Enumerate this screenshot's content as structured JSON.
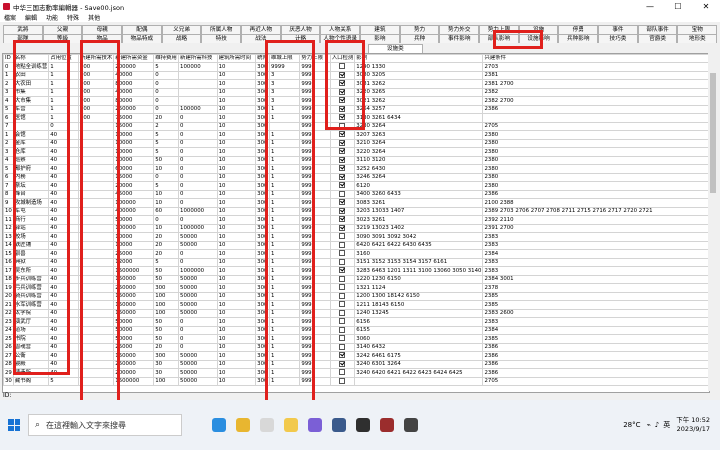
{
  "window": {
    "title": "中华三国志動率編輯器 - Save00.json",
    "minimize": "—",
    "maximize": "☐",
    "close": "✕"
  },
  "menu": [
    "檔案",
    "編輯",
    "功能",
    "特殊",
    "其他"
  ],
  "tabs_row1": [
    "武將",
    "父親",
    "母親",
    "配偶",
    "义兄弟",
    "所属人物",
    "再近人物",
    "厌恶人物",
    "人物关系",
    "建筑",
    "势力",
    "势力外交",
    "势力上限",
    "设施",
    "停勇",
    "事件",
    "部队事件",
    "宝物"
  ],
  "tabs_row2": [
    "部隊",
    "等級",
    "物品",
    "物品特成",
    "战略",
    "特技",
    "战法",
    "计略",
    "人物个性语录",
    "影响",
    "兵种",
    "事件影响",
    "部队影响",
    "设施影响",
    "兵种影响",
    "技巧类",
    "官爵类",
    "地形类"
  ],
  "active_tab": "设施类",
  "columns": [
    "ID",
    "名称",
    "占用位置",
    "新建所需技术",
    "新建所需资金",
    "维持费用",
    "新建所需科技",
    "建筑所需时间",
    "统帅",
    "维城上限",
    "势力上限",
    "入口检测",
    "影响",
    "兴建条件"
  ],
  "rows": [
    [
      "0",
      "地點全训练营",
      "1",
      "100",
      "200000",
      "5",
      "100000",
      "10",
      "300",
      "9999",
      "9999",
      "☐",
      "1290 1330",
      "2703"
    ],
    [
      "1",
      "农田",
      "1",
      "100",
      "40000",
      "0",
      "",
      "10",
      "300",
      "3",
      "9999",
      "☑",
      "3080 3205",
      "2381"
    ],
    [
      "2",
      "大农田",
      "1",
      "100",
      "80000",
      "0",
      "",
      "10",
      "300",
      "3",
      "9999",
      "☑",
      "3081 3262",
      "2381 2700"
    ],
    [
      "3",
      "市集",
      "1",
      "100",
      "40000",
      "0",
      "",
      "10",
      "300",
      "3",
      "9999",
      "☑",
      "3220 3265",
      "2382"
    ],
    [
      "4",
      "大市集",
      "1",
      "100",
      "80000",
      "0",
      "",
      "10",
      "300",
      "3",
      "9999",
      "☑",
      "3021 3262",
      "2382 2700"
    ],
    [
      "5",
      "军营",
      "1",
      "100",
      "250000",
      "0",
      "100000",
      "10",
      "300",
      "1",
      "9999",
      "☑",
      "3264 3257",
      "2386"
    ],
    [
      "6",
      "医馆",
      "1",
      "100",
      "75000",
      "20",
      "0",
      "10",
      "300",
      "1",
      "9999",
      "☑",
      "3130 3261 6434",
      ""
    ],
    [
      "7",
      "",
      "0",
      "",
      "15000",
      "2",
      "0",
      "10",
      "300",
      "",
      "9999",
      "☐",
      "3230 3264",
      "2705"
    ],
    [
      "1",
      "会馆",
      "40",
      "1",
      "10000",
      "5",
      "0",
      "10",
      "300",
      "1",
      "9999",
      "☑",
      "3207 3263",
      "2380"
    ],
    [
      "2",
      "金库",
      "40",
      "1",
      "10000",
      "5",
      "0",
      "10",
      "300",
      "1",
      "9999",
      "☑",
      "3210 3264",
      "2380"
    ],
    [
      "3",
      "仓库",
      "40",
      "1",
      "10000",
      "5",
      "0",
      "10",
      "300",
      "1",
      "9999",
      "☑",
      "3220 3264",
      "2380"
    ],
    [
      "4",
      "巡察",
      "40",
      "1",
      "10000",
      "50",
      "0",
      "10",
      "300",
      "1",
      "9999",
      "☑",
      "3110 3120",
      "2380"
    ],
    [
      "5",
      "都护府",
      "40",
      "1",
      "60000",
      "10",
      "0",
      "10",
      "300",
      "1",
      "9999",
      "☑",
      "3252 6430",
      "2380"
    ],
    [
      "6",
      "内務",
      "40",
      "1",
      "15000",
      "0",
      "0",
      "10",
      "300",
      "1",
      "9999",
      "☑",
      "3246 3264",
      "2380"
    ],
    [
      "7",
      "祭坛",
      "40",
      "1",
      "20000",
      "5",
      "0",
      "10",
      "300",
      "1",
      "9999",
      "☑",
      "6120",
      "2380"
    ],
    [
      "8",
      "烽台",
      "40",
      "1",
      "45000",
      "10",
      "0",
      "10",
      "300",
      "1",
      "9999",
      "☐",
      "3400 3260 6433",
      "2386"
    ],
    [
      "9",
      "攻城制造场",
      "40",
      "1",
      "100000",
      "10",
      "0",
      "10",
      "300",
      "1",
      "9999",
      "☑",
      "3083 3261",
      "2100 2388"
    ],
    [
      "10",
      "军屯",
      "40",
      "1",
      "400000",
      "60",
      "1000000",
      "10",
      "300",
      "1",
      "9999",
      "☑",
      "3203 13033 1407",
      "2389 2703 2706 2707 2708 2711 2715 2716 2717 2720 2721"
    ],
    [
      "11",
      "商行",
      "40",
      "1",
      "50000",
      "0",
      "0",
      "10",
      "300",
      "1",
      "9999",
      "☑",
      "3023 3261",
      "2392 2110"
    ],
    [
      "12",
      "驿站",
      "40",
      "1",
      "100000",
      "10",
      "1000000",
      "10",
      "300",
      "1",
      "9999",
      "☑",
      "3219 13023 1402",
      "2391 2700"
    ],
    [
      "13",
      "校场",
      "40",
      "1",
      "10000",
      "20",
      "50000",
      "10",
      "300",
      "1",
      "9999",
      "☐",
      "3090 3091 3092 3042",
      "2383"
    ],
    [
      "14",
      "铁匠铺",
      "40",
      "1",
      "10000",
      "20",
      "50000",
      "10",
      "300",
      "1",
      "9999",
      "☐",
      "6420 6421 6422 6430 6435",
      "2383"
    ],
    [
      "15",
      "驯兽",
      "40",
      "1",
      "25000",
      "20",
      "0",
      "10",
      "300",
      "1",
      "9999",
      "☐",
      "3160",
      "2384"
    ],
    [
      "16",
      "典狱",
      "40",
      "1",
      "12000",
      "5",
      "0",
      "10",
      "300",
      "1",
      "9999",
      "☐",
      "3151 3152 3153 3154 3157 6161",
      "2383"
    ],
    [
      "17",
      "吴东所",
      "40",
      "1",
      "1500000",
      "50",
      "1000000",
      "10",
      "300",
      "1",
      "9999",
      "☑",
      "3283 6463 1201 1311 3100 13060 3050 3140",
      "2383"
    ],
    [
      "18",
      "步兵训练营",
      "40",
      "1",
      "150000",
      "50",
      "50000",
      "10",
      "300",
      "1",
      "9999",
      "☐",
      "1220 1230 6150",
      "2384 3001"
    ],
    [
      "19",
      "弓兵训练营",
      "40",
      "1",
      "250000",
      "300",
      "50000",
      "10",
      "300",
      "1",
      "9999",
      "☐",
      "1321 1124",
      "2378"
    ],
    [
      "20",
      "骑兵训练营",
      "40",
      "1",
      "150000",
      "100",
      "50000",
      "10",
      "300",
      "1",
      "9999",
      "☐",
      "1200 1300 18142 6150",
      "2385"
    ],
    [
      "21",
      "水军训练营",
      "40",
      "1",
      "150000",
      "100",
      "50000",
      "10",
      "300",
      "1",
      "9999",
      "☐",
      "1211 18143 6150",
      "2385"
    ],
    [
      "22",
      "太学院",
      "40",
      "1",
      "150000",
      "100",
      "50000",
      "10",
      "300",
      "1",
      "9999",
      "☐",
      "1240 13245",
      "2383 2600"
    ],
    [
      "23",
      "演武厅",
      "40",
      "1",
      "50000",
      "50",
      "0",
      "10",
      "300",
      "1",
      "9999",
      "☐",
      "6156",
      "2383"
    ],
    [
      "24",
      "道场",
      "40",
      "1",
      "50000",
      "50",
      "0",
      "10",
      "300",
      "1",
      "9999",
      "☐",
      "6155",
      "2384"
    ],
    [
      "25",
      "书院",
      "40",
      "1",
      "50000",
      "50",
      "0",
      "10",
      "300",
      "1",
      "9999",
      "☐",
      "3060",
      "2385"
    ],
    [
      "26",
      "兽魂营",
      "40",
      "1",
      "25000",
      "20",
      "0",
      "10",
      "300",
      "1",
      "9999",
      "☐",
      "3140 6432",
      "2386"
    ],
    [
      "27",
      "公衛",
      "40",
      "1",
      "150000",
      "300",
      "50000",
      "10",
      "300",
      "1",
      "9999",
      "☑",
      "3242 6461 6175",
      "2386"
    ],
    [
      "28",
      "寝殿",
      "40",
      "1",
      "250000",
      "30",
      "50000",
      "10",
      "300",
      "1",
      "9999",
      "☑",
      "3240 6301 3264",
      "2386"
    ],
    [
      "29",
      "铸造所",
      "40",
      "1",
      "200000",
      "30",
      "50000",
      "10",
      "300",
      "1",
      "9999",
      "☐",
      "3240 6420 6421 6422 6423 6424 6425",
      "2386"
    ],
    [
      "30",
      "藏书阁",
      "5",
      "1",
      "1500000",
      "100",
      "50000",
      "10",
      "300",
      "1",
      "9999",
      "☐",
      "",
      "2705"
    ]
  ],
  "status_label": "ID:",
  "search_placeholder": "在這裡輸入文字來搜尋",
  "tray": {
    "temp": "28°C",
    "ime": "英",
    "time": "下午 10:52",
    "date": "2023/9/17"
  }
}
